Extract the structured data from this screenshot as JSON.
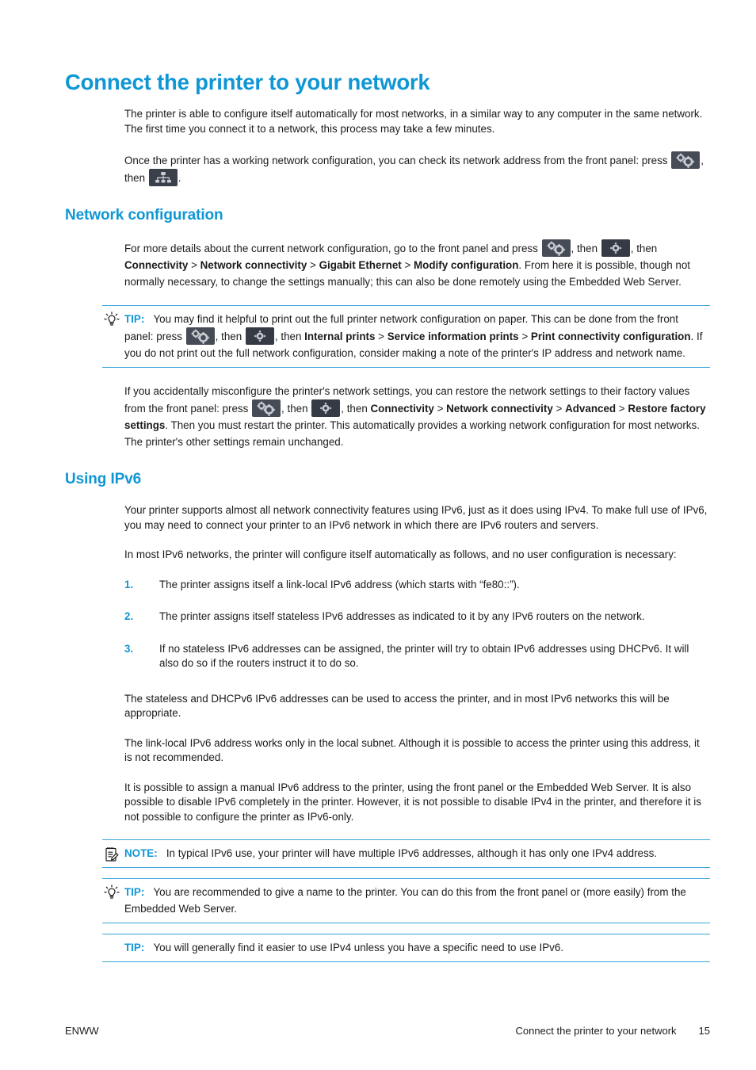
{
  "page": {
    "chapter_title": "Connect the printer to your network"
  },
  "intro": {
    "p1": "The printer is able to configure itself automatically for most networks, in a similar way to any computer in the same network. The first time you connect it to a network, this process may take a few minutes.",
    "p2_part1": "Once the printer has a working network configuration, you can check its network address from the front panel: press ",
    "p2_part2": ", then ",
    "p2_part3": "."
  },
  "network_configuration": {
    "heading": "Network configuration",
    "p1_part1": "For more details about the current network configuration, go to the front panel and press ",
    "p1_part2": ", then ",
    "p1_part3": ", then ",
    "p1_bold1": "Connectivity",
    "p1_sep1": " > ",
    "p1_bold2": "Network connectivity",
    "p1_sep2": " > ",
    "p1_bold3": "Gigabit Ethernet",
    "p1_sep3": " > ",
    "p1_bold4": "Modify configuration",
    "p1_tail": ". From here it is possible, though not normally necessary, to change the settings manually; this can also be done remotely using the Embedded Web Server."
  },
  "tip_print_config": {
    "label": "TIP:",
    "icon": "lightbulb-icon",
    "text_part1": "You may find it helpful to print out the full printer network configuration on paper. This can be done from the front panel: press ",
    "text_part2": ", then ",
    "text_part3": ", then ",
    "bold1": "Internal prints",
    "sep1": " > ",
    "bold2": "Service information prints",
    "sep2": " > ",
    "bold3": "Print connectivity configuration",
    "tail": ". If you do not print out the full network configuration, consider making a note of the printer's IP address and network name."
  },
  "restore": {
    "part1": "If you accidentally misconfigure the printer's network settings, you can restore the network settings to their factory values from the front panel: press ",
    "part2": ", then ",
    "part3": ", then ",
    "bold1": "Connectivity",
    "sep1": " > ",
    "bold2": "Network connectivity",
    "sep2": " > ",
    "bold3": "Advanced",
    "sep3": " > ",
    "bold4": "Restore factory settings",
    "tail": ". Then you must restart the printer. This automatically provides a working network configuration for most networks. The printer's other settings remain unchanged."
  },
  "using_ipv6": {
    "heading": "Using IPv6",
    "p1": "Your printer supports almost all network connectivity features using IPv6, just as it does using IPv4. To make full use of IPv6, you may need to connect your printer to an IPv6 network in which there are IPv6 routers and servers.",
    "p2": "In most IPv6 networks, the printer will configure itself automatically as follows, and no user configuration is necessary:",
    "steps": [
      {
        "num": "1.",
        "text": "The printer assigns itself a link-local IPv6 address (which starts with “fe80::”)."
      },
      {
        "num": "2.",
        "text": "The printer assigns itself stateless IPv6 addresses as indicated to it by any IPv6 routers on the network."
      },
      {
        "num": "3.",
        "text": "If no stateless IPv6 addresses can be assigned, the printer will try to obtain IPv6 addresses using DHCPv6. It will also do so if the routers instruct it to do so."
      }
    ],
    "p3": "The stateless and DHCPv6 IPv6 addresses can be used to access the printer, and in most IPv6 networks this will be appropriate.",
    "p4": "The link-local IPv6 address works only in the local subnet. Although it is possible to access the printer using this address, it is not recommended.",
    "p5": "It is possible to assign a manual IPv6 address to the printer, using the front panel or the Embedded Web Server. It is also possible to disable IPv6 completely in the printer. However, it is not possible to disable IPv4 in the printer, and therefore it is not possible to configure the printer as IPv6-only."
  },
  "note_ipv6": {
    "label": "NOTE:",
    "icon": "notepad-icon",
    "text": "In typical IPv6 use, your printer will have multiple IPv6 addresses, although it has only one IPv4 address."
  },
  "tip_name": {
    "label": "TIP:",
    "icon": "lightbulb-icon",
    "text": "You are recommended to give a name to the printer. You can do this from the front panel or (more easily) from the Embedded Web Server."
  },
  "tip_ipv4": {
    "label": "TIP:",
    "text": "You will generally find it easier to use IPv4 unless you have a specific need to use IPv6."
  },
  "icons": {
    "gears": "front-panel-gears-icon",
    "gear": "front-panel-gear-icon",
    "network": "front-panel-network-icon"
  },
  "footer": {
    "left": "ENWW",
    "center": "Connect the printer to your network",
    "page_number": "15"
  },
  "colors": {
    "accent_blue": "#0f96d5",
    "rule_blue": "#3aa5dd",
    "body_text": "#1b1b1b",
    "icon_bg_dark": "#353b44",
    "icon_bg_light": "#464c56"
  }
}
